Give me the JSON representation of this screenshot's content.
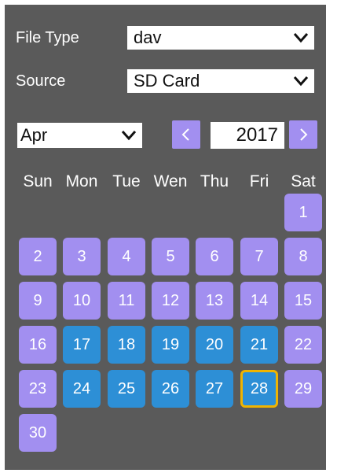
{
  "file_type": {
    "label": "File Type",
    "value": "dav"
  },
  "source": {
    "label": "Source",
    "value": "SD Card"
  },
  "calendar": {
    "month": "Apr",
    "year": "2017",
    "prev_icon": "chevron-left-icon",
    "next_icon": "chevron-right-icon",
    "weekdays": [
      "Sun",
      "Mon",
      "Tue",
      "Wen",
      "Thu",
      "Fri",
      "Sat"
    ],
    "days": [
      {
        "n": "1",
        "rec": false
      },
      {
        "n": "2",
        "rec": false
      },
      {
        "n": "3",
        "rec": false
      },
      {
        "n": "4",
        "rec": false
      },
      {
        "n": "5",
        "rec": false
      },
      {
        "n": "6",
        "rec": false
      },
      {
        "n": "7",
        "rec": false
      },
      {
        "n": "8",
        "rec": false
      },
      {
        "n": "9",
        "rec": false
      },
      {
        "n": "10",
        "rec": false
      },
      {
        "n": "11",
        "rec": false
      },
      {
        "n": "12",
        "rec": false
      },
      {
        "n": "13",
        "rec": false
      },
      {
        "n": "14",
        "rec": false
      },
      {
        "n": "15",
        "rec": false
      },
      {
        "n": "16",
        "rec": false
      },
      {
        "n": "17",
        "rec": true
      },
      {
        "n": "18",
        "rec": true
      },
      {
        "n": "19",
        "rec": true
      },
      {
        "n": "20",
        "rec": true
      },
      {
        "n": "21",
        "rec": true
      },
      {
        "n": "22",
        "rec": false
      },
      {
        "n": "23",
        "rec": false
      },
      {
        "n": "24",
        "rec": true
      },
      {
        "n": "25",
        "rec": true
      },
      {
        "n": "26",
        "rec": true
      },
      {
        "n": "27",
        "rec": true
      },
      {
        "n": "28",
        "rec": true,
        "today": true
      },
      {
        "n": "29",
        "rec": false
      },
      {
        "n": "30",
        "rec": false
      }
    ]
  },
  "colors": {
    "panel_bg": "#5a5a5a",
    "day_available": "#a28ff0",
    "day_has_record": "#2d8fd6",
    "today_outline": "#f0b400"
  }
}
